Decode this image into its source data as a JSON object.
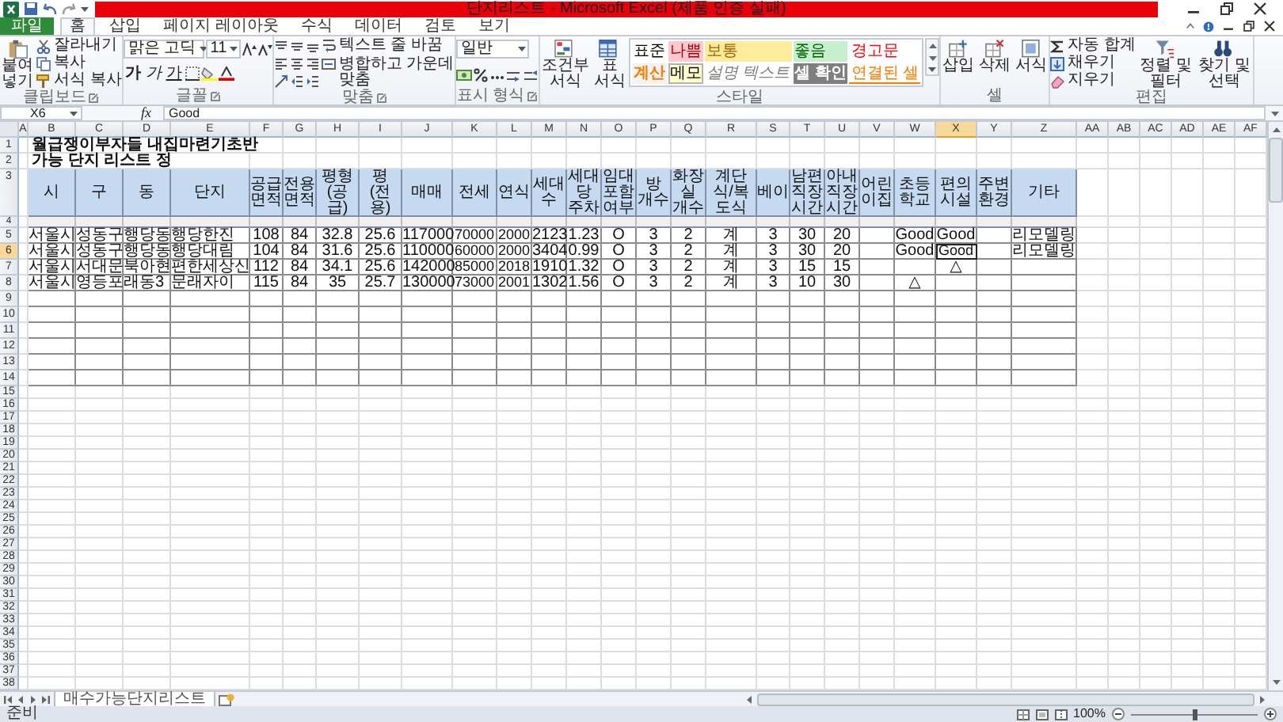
{
  "window": {
    "title": "단지리스트 - Microsoft Excel (제품 인증 실패)"
  },
  "ribbon_tabs": [
    {
      "label": "파일",
      "kind": "file",
      "selected": false
    },
    {
      "label": "홈",
      "kind": "tab",
      "selected": true
    },
    {
      "label": "삽입",
      "kind": "tab",
      "selected": false
    },
    {
      "label": "페이지 레이아웃",
      "kind": "tab",
      "selected": false
    },
    {
      "label": "수식",
      "kind": "tab",
      "selected": false
    },
    {
      "label": "데이터",
      "kind": "tab",
      "selected": false
    },
    {
      "label": "검토",
      "kind": "tab",
      "selected": false
    },
    {
      "label": "보기",
      "kind": "tab",
      "selected": false
    }
  ],
  "ribbon_groups": [
    {
      "label": "클립보드",
      "kind": "clipboard",
      "launcher": true,
      "large": [
        "붙여넣기"
      ],
      "small": [
        "잘라내기",
        "복사",
        "서식 복사"
      ]
    },
    {
      "label": "글꼴",
      "kind": "font",
      "launcher": true,
      "font": "맑은 고딕",
      "size": "11",
      "style_buttons": [
        "가",
        "가",
        "가"
      ]
    },
    {
      "label": "맞춤",
      "kind": "alignment",
      "launcher": true,
      "small": [
        "텍스트 줄 바꿈",
        "병합하고 가운데 맞춤"
      ]
    },
    {
      "label": "표시 형식",
      "kind": "number",
      "launcher": true,
      "format": "일반"
    },
    {
      "label": "스타일",
      "kind": "styles",
      "launcher": false,
      "large": [
        "조건부 서식",
        "표 서식"
      ],
      "styles": [
        {
          "label": "표준",
          "kind": "normal",
          "color": "#ffffff"
        },
        {
          "label": "나쁨",
          "kind": "bad",
          "color": "#ffc7ce"
        },
        {
          "label": "보통",
          "kind": "neutral",
          "color": "#ffeb9c"
        },
        {
          "label": "좋음",
          "kind": "good",
          "color": "#c6efce"
        },
        {
          "label": "경고문",
          "kind": "warning",
          "color": "#ffffff"
        },
        {
          "label": "계산",
          "kind": "calculation",
          "color": "#f2f2f2"
        },
        {
          "label": "메모",
          "kind": "note",
          "color": "#ffffcc"
        },
        {
          "label": "설명 텍스트",
          "kind": "explanatory",
          "color": "#ffffff"
        },
        {
          "label": "셀 확인",
          "kind": "check",
          "color": "#7f7f7f"
        },
        {
          "label": "연결된 셀",
          "kind": "linked",
          "color": "#ffffff"
        }
      ]
    },
    {
      "label": "셀",
      "kind": "cells",
      "launcher": false,
      "large": [
        "삽입",
        "삭제",
        "서식"
      ]
    },
    {
      "label": "편집",
      "kind": "editing",
      "launcher": false,
      "small": [
        "자동 합계",
        "채우기",
        "지우기"
      ],
      "large": [
        "정렬 및 필터",
        "찾기 및 선택"
      ]
    }
  ],
  "formula_bar": {
    "name_box": "X6",
    "function_button": "fx",
    "formula": "Good"
  },
  "sheet": {
    "columns": [
      {
        "label": "A",
        "selected": false
      },
      {
        "label": "B",
        "selected": false
      },
      {
        "label": "C",
        "selected": false
      },
      {
        "label": "D",
        "selected": false
      },
      {
        "label": "E",
        "selected": false
      },
      {
        "label": "F",
        "selected": false
      },
      {
        "label": "G",
        "selected": false
      },
      {
        "label": "H",
        "selected": false
      },
      {
        "label": "I",
        "selected": false
      },
      {
        "label": "J",
        "selected": false
      },
      {
        "label": "K",
        "selected": false
      },
      {
        "label": "L",
        "selected": false
      },
      {
        "label": "M",
        "selected": false
      },
      {
        "label": "N",
        "selected": false
      },
      {
        "label": "O",
        "selected": false
      },
      {
        "label": "P",
        "selected": false
      },
      {
        "label": "Q",
        "selected": false
      },
      {
        "label": "R",
        "selected": false
      },
      {
        "label": "S",
        "selected": false
      },
      {
        "label": "T",
        "selected": false
      },
      {
        "label": "U",
        "selected": false
      },
      {
        "label": "V",
        "selected": false
      },
      {
        "label": "W",
        "selected": false
      },
      {
        "label": "X",
        "selected": true
      },
      {
        "label": "Y",
        "selected": false
      },
      {
        "label": "Z",
        "selected": false
      },
      {
        "label": "AA",
        "selected": false
      },
      {
        "label": "AB",
        "selected": false
      },
      {
        "label": "AC",
        "selected": false
      },
      {
        "label": "AD",
        "selected": false
      },
      {
        "label": "AE",
        "selected": false
      },
      {
        "label": "AF",
        "selected": false
      }
    ],
    "rows": [
      {
        "label": "1",
        "selected": false
      },
      {
        "label": "2",
        "selected": false
      },
      {
        "label": "3",
        "selected": false
      },
      {
        "label": "4",
        "selected": false
      },
      {
        "label": "5",
        "selected": false
      },
      {
        "label": "6",
        "selected": true
      },
      {
        "label": "7",
        "selected": false
      },
      {
        "label": "8",
        "selected": false
      },
      {
        "label": "9",
        "selected": false
      },
      {
        "label": "10",
        "selected": false
      },
      {
        "label": "11",
        "selected": false
      },
      {
        "label": "12",
        "selected": false
      },
      {
        "label": "13",
        "selected": false
      },
      {
        "label": "14",
        "selected": false
      },
      {
        "label": "15",
        "selected": false
      },
      {
        "label": "16",
        "selected": false
      },
      {
        "label": "17",
        "selected": false
      },
      {
        "label": "18",
        "selected": false
      },
      {
        "label": "19",
        "selected": false
      },
      {
        "label": "20",
        "selected": false
      },
      {
        "label": "21",
        "selected": false
      },
      {
        "label": "22",
        "selected": false
      },
      {
        "label": "23",
        "selected": false
      },
      {
        "label": "24",
        "selected": false
      },
      {
        "label": "25",
        "selected": false
      },
      {
        "label": "26",
        "selected": false
      },
      {
        "label": "27",
        "selected": false
      },
      {
        "label": "28",
        "selected": false
      },
      {
        "label": "29",
        "selected": false
      },
      {
        "label": "30",
        "selected": false
      },
      {
        "label": "31",
        "selected": false
      },
      {
        "label": "32",
        "selected": false
      },
      {
        "label": "33",
        "selected": false
      },
      {
        "label": "34",
        "selected": false
      },
      {
        "label": "35",
        "selected": false
      },
      {
        "label": "36",
        "selected": false
      },
      {
        "label": "37",
        "selected": false
      },
      {
        "label": "38",
        "selected": false
      }
    ],
    "title_lines": [
      "월급쟁이부자들 내집마련기초반",
      "가능 단지 리스트 정"
    ],
    "table": {
      "headers": [
        "시",
        "구",
        "동",
        "단지",
        "공급 면적",
        "전용 면적",
        "평형 (공급)",
        "평 (전용)",
        "매매",
        "전세",
        "연식",
        "세대수",
        "세대당 주차",
        "임대포함 여부",
        "방 개수",
        "화장실 개수",
        "계단식/복도식",
        "베이",
        "남편직장 시간",
        "아내직장 시간",
        "어린이집",
        "초등학교",
        "편의시설",
        "주변환경",
        "기타"
      ],
      "rows": [
        [
          "서울시",
          "성동구",
          "행당동",
          "행당한진",
          "108",
          "84",
          "32.8",
          "25.6",
          "117000",
          "70000",
          "2000",
          "2123",
          "1.23",
          "O",
          "3",
          "2",
          "계",
          "3",
          "30",
          "20",
          null,
          "Good",
          "Good",
          null,
          "리모델링"
        ],
        [
          "서울시",
          "성동구",
          "행당동",
          "행당대림",
          "104",
          "84",
          "31.6",
          "25.6",
          "110000",
          "60000",
          "2000",
          "3404",
          "0.99",
          "O",
          "3",
          "2",
          "계",
          "3",
          "30",
          "20",
          null,
          "Good",
          "Good",
          null,
          "리모델링"
        ],
        [
          "서울시",
          "서대문",
          "북아현",
          "편한세상신",
          "112",
          "84",
          "34.1",
          "25.6",
          "142000",
          "85000",
          "2018",
          "1910",
          "1.32",
          "O",
          "3",
          "2",
          "계",
          "3",
          "15",
          "15",
          null,
          null,
          "△",
          null,
          null
        ],
        [
          "서울시",
          "영등포",
          "래동3",
          "문래자이",
          "115",
          "84",
          "35",
          "25.7",
          "130000",
          "73000",
          "2001",
          "1302",
          "1.56",
          "O",
          "3",
          "2",
          "계",
          "3",
          "10",
          "30",
          null,
          "△",
          null,
          null,
          null
        ]
      ]
    }
  },
  "sheet_tabs": [
    {
      "label": "매수가능단지리스트",
      "selected": true
    }
  ],
  "status_bar": {
    "text": "준비",
    "zoom": "100%",
    "level": 0.5
  }
}
